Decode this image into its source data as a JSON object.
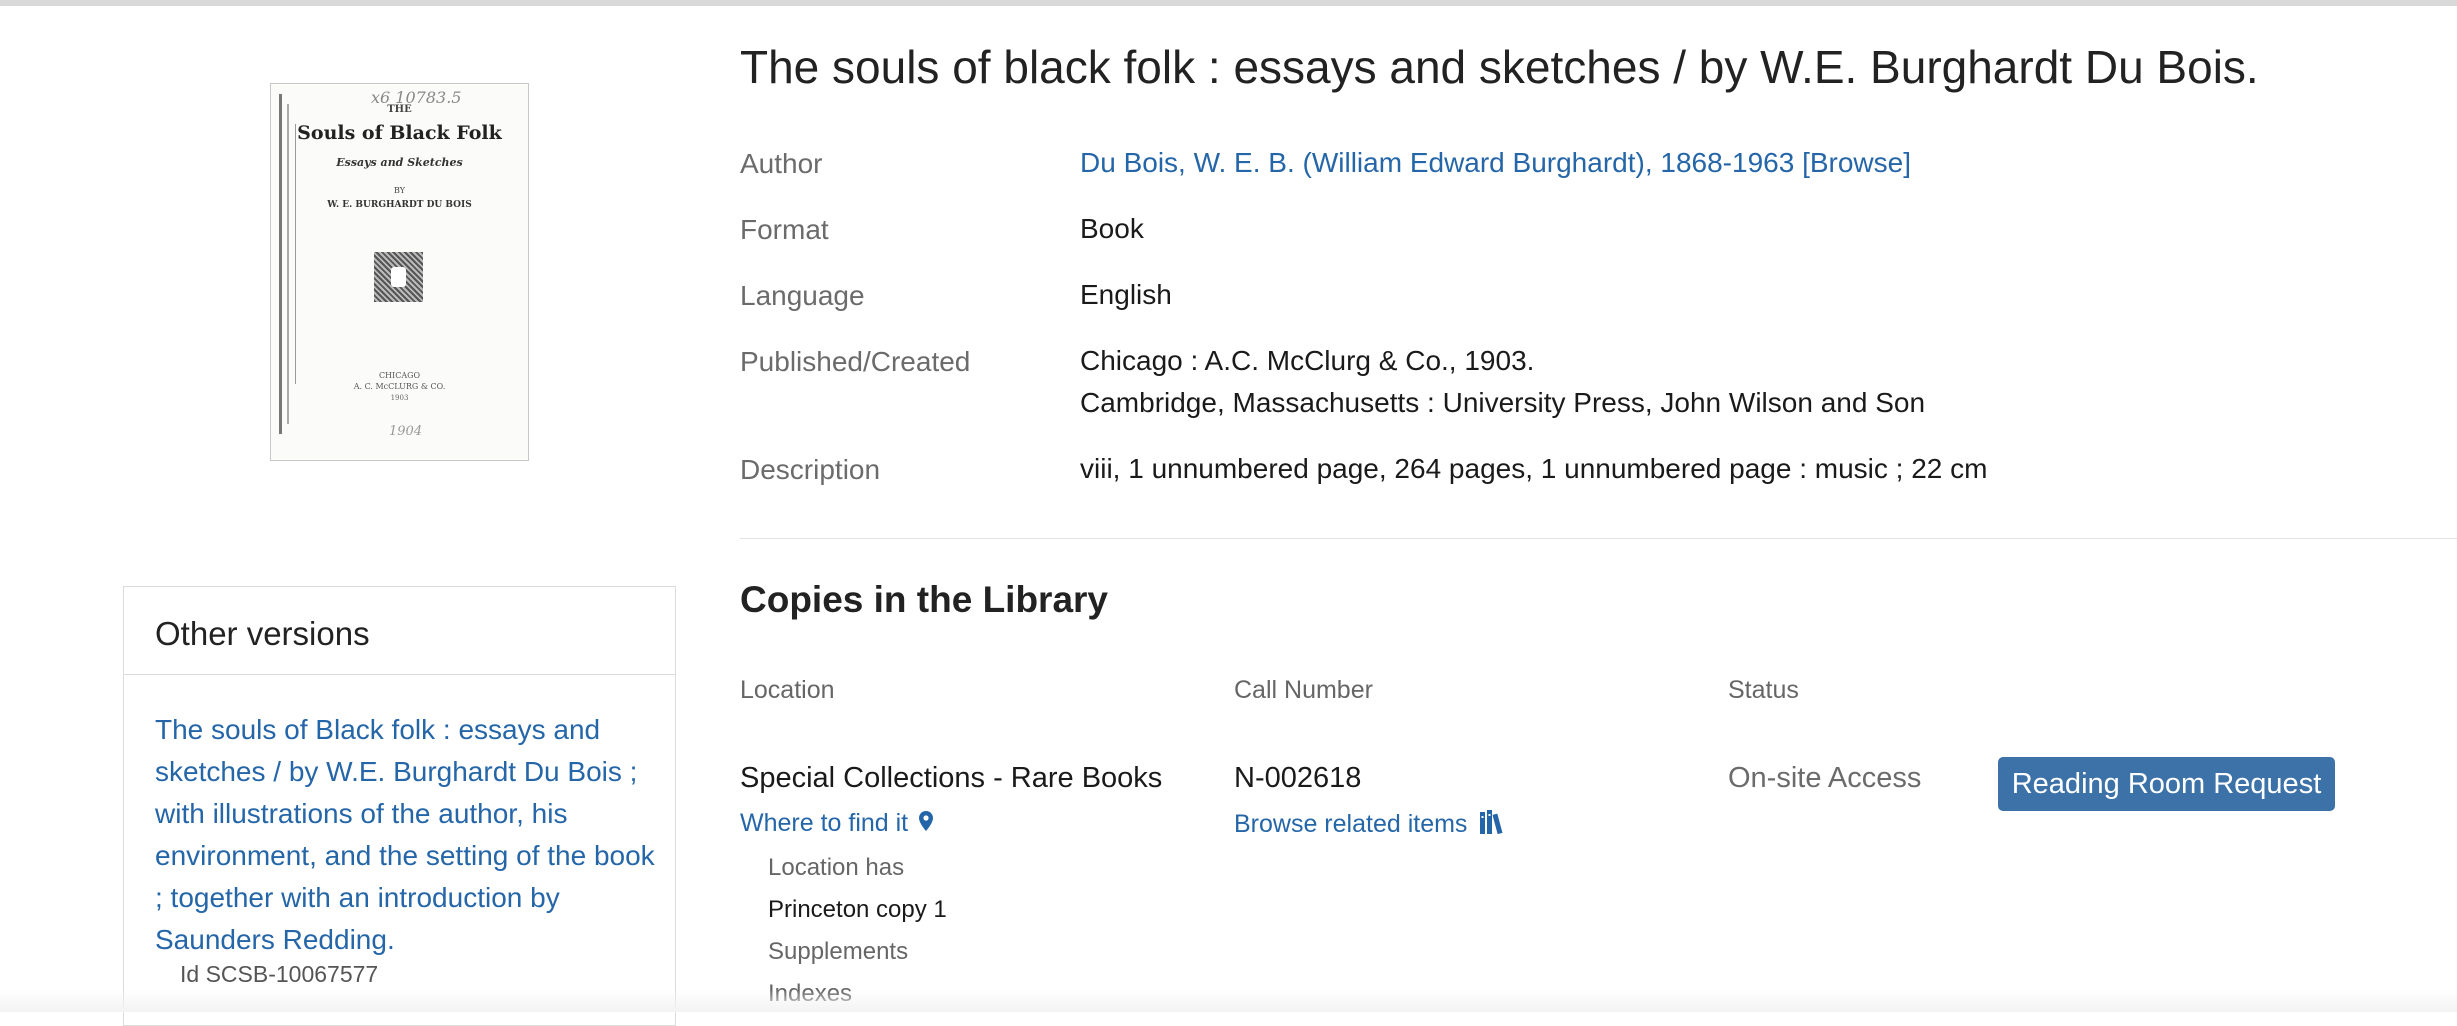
{
  "record": {
    "title": "The souls of black folk : essays and sketches / by W.E. Burghardt Du Bois.",
    "fields": {
      "author_label": "Author",
      "author_value": "Du Bois, W. E. B. (William Edward Burghardt), 1868-1963 [Browse]",
      "format_label": "Format",
      "format_value": "Book",
      "language_label": "Language",
      "language_value": "English",
      "published_label": "Published/Created",
      "published_line1": "Chicago : A.C. McClurg & Co., 1903.",
      "published_line2": "Cambridge, Massachusetts : University Press, John Wilson and Son",
      "description_label": "Description",
      "description_value": "viii, 1 unnumbered page, 264 pages, 1 unnumbered page : music ; 22 cm"
    }
  },
  "cover": {
    "handwritten": "x6 10783.5",
    "the": "THE",
    "title": "Souls of Black Folk",
    "subtitle": "Essays and Sketches",
    "by": "BY",
    "author": "W. E. BURGHARDT DU BOIS",
    "city": "CHICAGO",
    "publisher": "A. C. McCLURG & CO.",
    "year": "1903",
    "handwritten2": "1904"
  },
  "other_versions": {
    "heading": "Other versions",
    "link_text": "The souls of Black folk : essays and sketches / by W.E. Burghardt Du Bois ; with illustrations of the author, his environment, and the setting of the book ; together with an introduction by Saunders Redding.",
    "id_text": "Id SCSB-10067577"
  },
  "copies": {
    "heading": "Copies in the Library",
    "col_location": "Location",
    "col_call_number": "Call Number",
    "col_status": "Status",
    "location_name": "Special Collections - Rare Books",
    "where_to_find": "Where to find it",
    "location_has_label": "Location has",
    "location_has_value": "Princeton copy 1",
    "supplements_label": "Supplements",
    "indexes_label": "Indexes",
    "call_number": "N-002618",
    "browse_related": "Browse related items",
    "status": "On-site Access",
    "request_button": "Reading Room Request"
  },
  "colors": {
    "link": "#2566a8",
    "button": "#3d72a8",
    "label": "#6b6b6b"
  }
}
